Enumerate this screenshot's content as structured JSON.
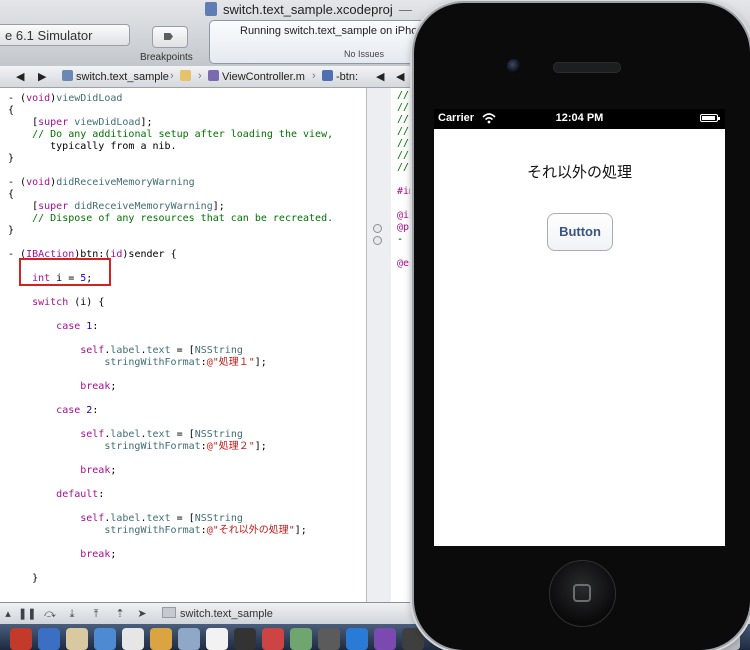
{
  "toolbar": {
    "scheme": "e 6.1 Simulator",
    "breakpoints_label": "Breakpoints",
    "window_title": "switch.text_sample.xcodeproj",
    "window_title_dash": "—",
    "status_running": "Running switch.text_sample on iPho",
    "status_issues": "No Issues"
  },
  "jumpbar": {
    "project": "switch.text_sample",
    "file": "ViewController.m",
    "method": "-btn:"
  },
  "editor": {
    "lines": [
      "- (void)viewDidLoad",
      "{",
      "    [super viewDidLoad];",
      "    // Do any additional setup after loading the view,",
      "       typically from a nib.",
      "}",
      "",
      "- (void)didReceiveMemoryWarning",
      "{",
      "    [super didReceiveMemoryWarning];",
      "    // Dispose of any resources that can be recreated.",
      "}",
      "",
      "- (IBAction)btn:(id)sender {",
      "",
      "    int i = 5;",
      "",
      "    switch (i) {",
      "",
      "        case 1:",
      "",
      "            self.label.text = [NSString",
      "                stringWithFormat:@\"処理１\"];",
      "",
      "            break;",
      "",
      "        case 2:",
      "",
      "            self.label.text = [NSString",
      "                stringWithFormat:@\"処理２\"];",
      "",
      "            break;",
      "",
      "        default:",
      "",
      "            self.label.text = [NSString",
      "                stringWithFormat:@\"それ以外の処理\"];",
      "",
      "            break;",
      "",
      "    }",
      ""
    ],
    "right_lines": [
      "//",
      "//",
      "//",
      "//",
      "//",
      "//",
      "//",
      "",
      "#im",
      "",
      "@in",
      "@pr",
      "- (",
      "",
      "@en"
    ]
  },
  "debugbar": {
    "target": "switch.text_sample",
    "buttons": [
      "pause-icon",
      "step-over-icon",
      "step-in-icon",
      "step-out-icon",
      "location-icon"
    ]
  },
  "simulator": {
    "carrier": "Carrier",
    "time": "12:04 PM",
    "battery_level": 0.9,
    "label_text": "それ以外の処理",
    "button_label": "Button"
  },
  "colors": {
    "keyword": "#aa0d91",
    "comment": "#007400",
    "string": "#c41a16",
    "number": "#1c00cf",
    "highlight": "#d42222",
    "ios_button_text": "#385487"
  }
}
